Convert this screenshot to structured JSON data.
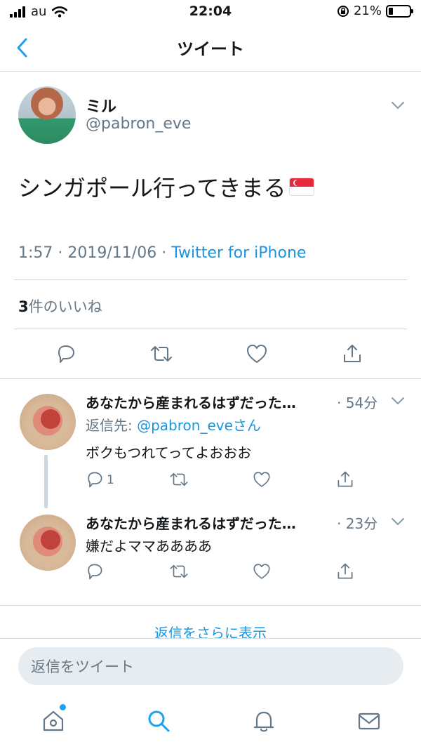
{
  "status_bar": {
    "carrier": "au",
    "time": "22:04",
    "battery": "21%"
  },
  "nav": {
    "title": "ツイート"
  },
  "tweet": {
    "name": "ミル",
    "handle": "@pabron_eve",
    "text": "シンガポール行ってきまる",
    "flag_icon": "singapore-flag-icon",
    "time": "1:57",
    "date": "2019/11/06",
    "source": "Twitter for iPhone",
    "likes_count": "3",
    "likes_label": "件のいいね"
  },
  "replies": [
    {
      "name": "あなたから産まれるはずだった…",
      "time": "· 54分",
      "reply_to_prefix": "返信先: ",
      "reply_to_mention": "@pabron_eve",
      "reply_to_suffix": "さん",
      "text": "ボクもつれてってよおおお",
      "reply_count": "1"
    },
    {
      "name": "あなたから産まれるはずだった…",
      "time": "· 23分",
      "text": "嫌だよママああああ"
    }
  ],
  "more_replies": "返信をさらに表示",
  "compose": {
    "placeholder": "返信をツイート"
  },
  "tabbar": {
    "items": [
      "home-icon",
      "search-icon",
      "notifications-icon",
      "messages-icon"
    ],
    "active": "search-icon",
    "accent": "#1da1f2"
  }
}
